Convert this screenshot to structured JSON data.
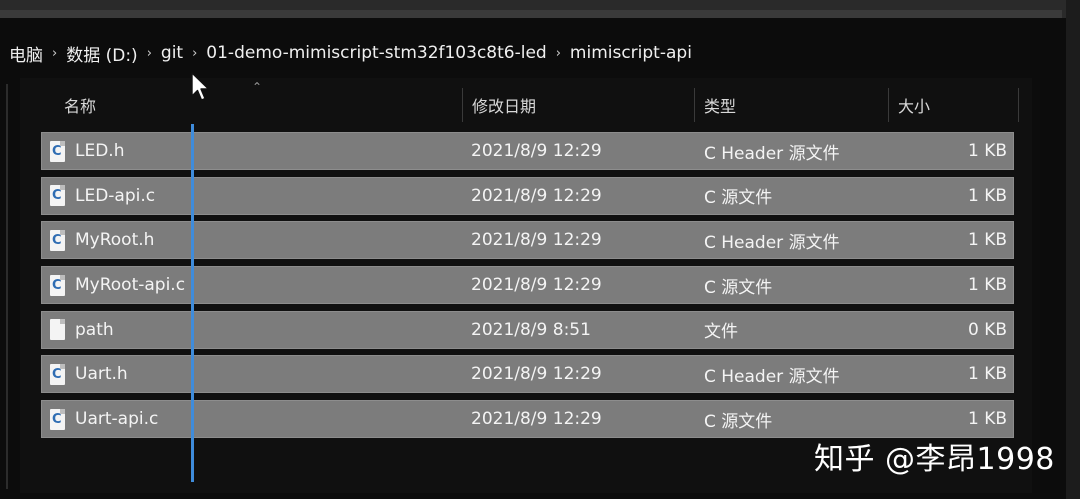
{
  "breadcrumb": [
    {
      "label": "电脑"
    },
    {
      "label": "数据 (D:)"
    },
    {
      "label": "git"
    },
    {
      "label": "01-demo-mimiscript-stm32f103c8t6-led"
    },
    {
      "label": "mimiscript-api"
    }
  ],
  "columns": {
    "name": "名称",
    "date": "修改日期",
    "type": "类型",
    "size": "大小"
  },
  "files": [
    {
      "icon": "c-file-icon",
      "name": "LED.h",
      "date": "2021/8/9 12:29",
      "type": "C Header 源文件",
      "size": "1 KB"
    },
    {
      "icon": "c-file-icon",
      "name": "LED-api.c",
      "date": "2021/8/9 12:29",
      "type": "C 源文件",
      "size": "1 KB"
    },
    {
      "icon": "c-file-icon",
      "name": "MyRoot.h",
      "date": "2021/8/9 12:29",
      "type": "C Header 源文件",
      "size": "1 KB"
    },
    {
      "icon": "c-file-icon",
      "name": "MyRoot-api.c",
      "date": "2021/8/9 12:29",
      "type": "C 源文件",
      "size": "1 KB"
    },
    {
      "icon": "generic-file-icon",
      "name": "path",
      "date": "2021/8/9 8:51",
      "type": "文件",
      "size": "0 KB"
    },
    {
      "icon": "c-file-icon",
      "name": "Uart.h",
      "date": "2021/8/9 12:29",
      "type": "C Header 源文件",
      "size": "1 KB"
    },
    {
      "icon": "c-file-icon",
      "name": "Uart-api.c",
      "date": "2021/8/9 12:29",
      "type": "C 源文件",
      "size": "1 KB"
    }
  ],
  "watermark": "知乎 @李昂1998",
  "colors": {
    "selection_bg": "#7c7c7c",
    "window_bg": "#0c0c0c",
    "accent_line": "#3f8cdb"
  }
}
